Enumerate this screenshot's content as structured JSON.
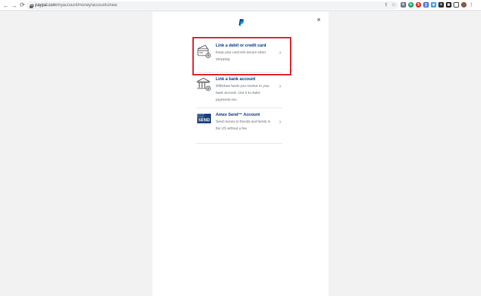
{
  "browser": {
    "url_host": "paypal.com",
    "url_path": "/myaccount/money/accounts/new",
    "back_icon": "←",
    "forward_icon": "→",
    "reload_icon": "⟳"
  },
  "dialog": {
    "close_label": "×",
    "options": [
      {
        "title": "Link a debit or credit card",
        "desc_line1": "Keep your card info secure when",
        "desc_line2": "shopping"
      },
      {
        "title": "Link a bank account",
        "desc_line1": "Withdraw funds you receive to your",
        "desc_line2": "bank account. Use it to make",
        "desc_line3": "payments too."
      },
      {
        "title": "Amex Send™ Account",
        "desc_line1": "Send money to friends and family in",
        "desc_line2": "the US without a fee.",
        "badge_small": "AMERICAN EXPRESS",
        "badge_text": "SEND"
      }
    ],
    "chevron": "›"
  },
  "colors": {
    "paypal_navy": "#003087",
    "paypal_blue": "#009cde",
    "highlight_red": "#e1141b"
  }
}
